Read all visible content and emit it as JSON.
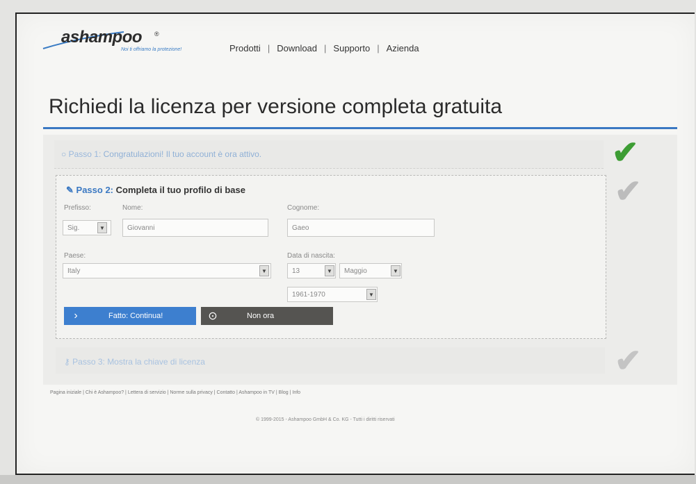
{
  "header": {
    "logo_text": "ashampoo",
    "logo_reg": "®",
    "tagline": "Noi ti offriamo la protezione!",
    "nav": [
      "Prodotti",
      "Download",
      "Supporto",
      "Azienda"
    ]
  },
  "page_title": "Richiedi la licenza per versione completa gratuita",
  "step1": {
    "prefix": "Passo 1:",
    "text": "Congratulazioni! Il tuo account è ora attivo."
  },
  "step2": {
    "prefix": "Passo 2:",
    "title": "Completa il tuo profilo di base",
    "labels": {
      "prefix": "Prefisso:",
      "name": "Nome:",
      "surname": "Cognome:",
      "country": "Paese:",
      "birthdate": "Data di nascita:"
    },
    "values": {
      "prefix": "Sig.",
      "name": "Giovanni",
      "surname": "Gaeo",
      "country": "Italy",
      "day": "13",
      "month": "Maggio",
      "year": "1961-1970"
    },
    "buttons": {
      "continue": "Fatto: Continua!",
      "cancel": "Non ora"
    }
  },
  "step3": {
    "prefix": "Passo 3:",
    "text": "Mostra la chiave di licenza"
  },
  "footer": {
    "links": "Pagina iniziale | Chi è Ashampoo? | Lettera di servizio | Norme sulla privacy | Contatto | Ashampoo in TV | Blog | Info",
    "copyright": "© 1999-2015 - Ashampoo GmbH & Co. KG - Tutti i diritti riservati"
  },
  "colors": {
    "accent_blue": "#3a78c2",
    "check_done": "#3d9d34",
    "check_pending": "#bcbcbc",
    "cancel_button": "#555451"
  },
  "icons": [
    "circle-icon",
    "pencil-icon",
    "key-icon",
    "checkmark-icon",
    "chevron-right-icon",
    "cancel-icon",
    "select-arrow-icon"
  ]
}
